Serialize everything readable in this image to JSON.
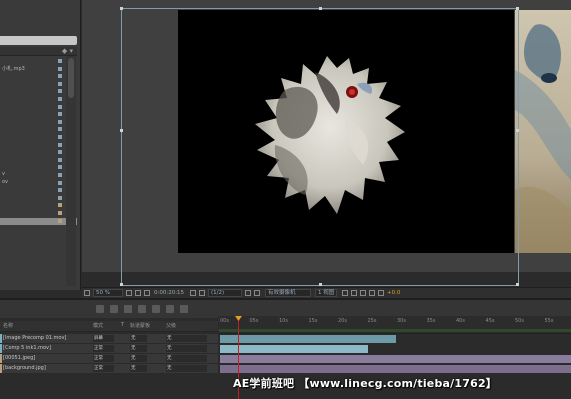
{
  "project": {
    "header_icon": "tag-icon",
    "files": [
      {
        "name": "",
        "color": "#8aa2b4"
      },
      {
        "name": "小札.mp3",
        "color": "#8aa2b4"
      },
      {
        "name": "",
        "color": "#8aa2b4"
      },
      {
        "name": "",
        "color": "#8aa2b4"
      },
      {
        "name": "",
        "color": "#8aa2b4"
      },
      {
        "name": "",
        "color": "#8aa2b4"
      },
      {
        "name": "",
        "color": "#8aa2b4"
      },
      {
        "name": "",
        "color": "#8aa2b4"
      },
      {
        "name": "",
        "color": "#8aa2b4"
      },
      {
        "name": "",
        "color": "#8aa2b4"
      },
      {
        "name": "",
        "color": "#8aa2b4"
      },
      {
        "name": "",
        "color": "#8aa2b4"
      },
      {
        "name": "",
        "color": "#8aa2b4"
      },
      {
        "name": "",
        "color": "#8aa2b4"
      },
      {
        "name": "",
        "color": "#8aa2b4"
      },
      {
        "name": "v",
        "color": "#8aa2b4"
      },
      {
        "name": "ov",
        "color": "#8aa2b4"
      },
      {
        "name": "",
        "color": "#8aa2b4"
      },
      {
        "name": "",
        "color": "#8aa2b4"
      },
      {
        "name": "",
        "color": "#b8a07c"
      },
      {
        "name": "",
        "color": "#b8a07c"
      },
      {
        "name": "",
        "color": "#b8a07c"
      }
    ]
  },
  "viewer_toolbar": {
    "zoom": "50 %",
    "timecode": "0:00:20:15",
    "resolution": "(1/2)",
    "camera": "有效摄像机",
    "views": "1 视图",
    "exposure": "+0.0"
  },
  "timeline": {
    "columns": {
      "layer_name": "名称",
      "mode": "模式",
      "t": "T",
      "trkmat": "轨道蒙板",
      "parent": "父级"
    },
    "ruler_ticks": [
      "00s",
      "05s",
      "10s",
      "15s",
      "20s",
      "25s",
      "30s",
      "35s",
      "40s",
      "45s",
      "50s",
      "55s"
    ],
    "layers": [
      {
        "name": "[Image Precomp 01.mov]",
        "mode": "屏幕",
        "trkmat": "无",
        "parent": "无",
        "color": "#7bb0c4"
      },
      {
        "name": "[Comp 5 ink1.mov]",
        "mode": "正常",
        "trkmat": "无",
        "parent": "无",
        "color": "#7bb0c4"
      },
      {
        "name": "[00051.jpeg]",
        "mode": "正常",
        "trkmat": "无",
        "parent": "无",
        "color": "#b8a07c"
      },
      {
        "name": "[background.jpg]",
        "mode": "正常",
        "trkmat": "无",
        "parent": "无",
        "color": "#b8a07c"
      }
    ]
  },
  "watermark": "AE学前班吧 【www.linecg.com/tieba/1762】"
}
